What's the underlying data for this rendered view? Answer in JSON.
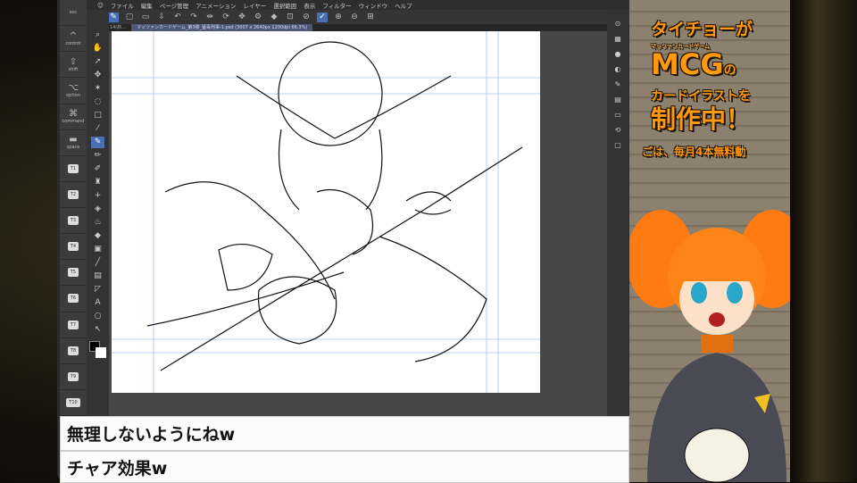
{
  "menu": [
    "ファイル",
    "編集",
    "ページ管理",
    "アニメーション",
    "レイヤー",
    "選択範囲",
    "表示",
    "フィルター",
    "ウィンドウ",
    "ヘルプ"
  ],
  "tabs": [
    "イラスト14(新...",
    "マッツァンカードゲーム_第3弾_猛毒刑事-1.psd (3007 x 2640px 1200dpi 66.3%)"
  ],
  "shortcut_keys": [
    {
      "glyph": "",
      "label": "esc"
    },
    {
      "glyph": "^",
      "label": "control"
    },
    {
      "glyph": "⇧",
      "label": "shift"
    },
    {
      "glyph": "⌥",
      "label": "option"
    },
    {
      "glyph": "⌘",
      "label": "command"
    },
    {
      "glyph": "▬",
      "label": "space"
    },
    {
      "tag": "T1"
    },
    {
      "tag": "T2"
    },
    {
      "tag": "T3"
    },
    {
      "tag": "T4"
    },
    {
      "tag": "T5"
    },
    {
      "tag": "T6"
    },
    {
      "tag": "T7"
    },
    {
      "tag": "T8"
    },
    {
      "tag": "T9"
    },
    {
      "tag": "T10"
    }
  ],
  "overlay": {
    "line1": "タイチョーが",
    "ruby": "マッツァンカードゲーム",
    "line2": "MCG",
    "line2b": "の",
    "line3": "カードイラストを",
    "line4": "制作中！",
    "line5": "ごは、毎月4本無料動"
  },
  "chat": [
    "無理しないようにねw",
    "チャア効果w"
  ],
  "colors": {
    "accent": "#ff9a10",
    "selected_tool": "#4a6fb5"
  }
}
